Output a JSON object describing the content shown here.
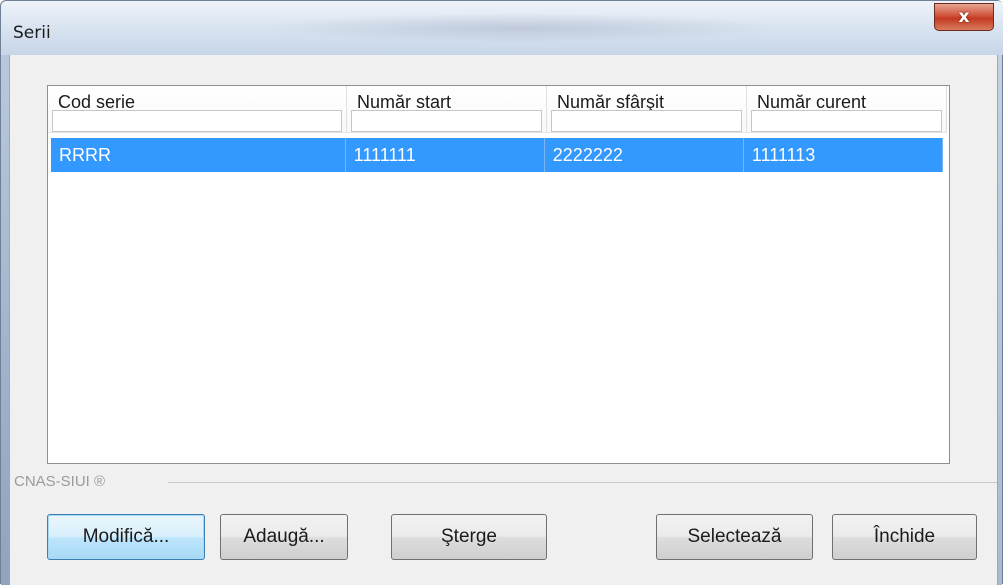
{
  "window": {
    "title": "Serii",
    "close_label": "x"
  },
  "list": {
    "columns": [
      "Cod serie",
      "Număr start",
      "Număr sfârşit",
      "Număr curent"
    ],
    "filters": [
      "",
      "",
      "",
      ""
    ],
    "rows": [
      {
        "cod_serie": "RRRR",
        "numar_start": "1111111",
        "numar_sfarsit": "2222222",
        "numar_curent": "1111113",
        "selected": true
      }
    ]
  },
  "footer": {
    "group_label": "CNAS-SIUI ®",
    "buttons": {
      "modifica": "Modifică...",
      "adauga": "Adaugă...",
      "sterge": "Şterge",
      "selecteaza": "Selectează",
      "inchide": "Închide"
    }
  },
  "colors": {
    "selection": "#3399ff",
    "close_button": "#c33a20"
  }
}
